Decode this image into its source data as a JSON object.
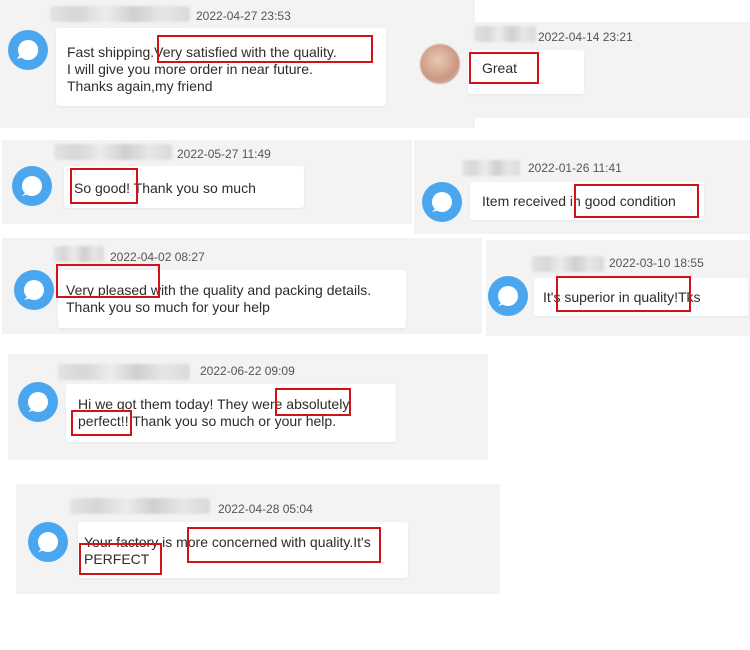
{
  "colors": {
    "card_bg": "#f3f3f3",
    "avatar": "#4aa6ee",
    "highlight": "#d0121b",
    "text": "#2c2c2c",
    "date": "#555555"
  },
  "icons": {
    "avatar": "default-avatar-icon"
  },
  "reviews": [
    {
      "date": "2022-04-27 23:53",
      "message": "Fast shipping.Very satisfied with the quality.\nI will give you more order in near future.\nThanks again,my friend"
    },
    {
      "date": "2022-04-14 23:21",
      "message": "Great"
    },
    {
      "date": "2022-05-27 11:49",
      "message": "So good! Thank you so much"
    },
    {
      "date": "2022-01-26 11:41",
      "message": "Item received in good condition"
    },
    {
      "date": "2022-04-02 08:27",
      "message": "Very pleased with the quality and packing details.\nThank you so much for your help"
    },
    {
      "date": "2022-03-10 18:55",
      "message": "It's superior in quality!Tks"
    },
    {
      "date": "2022-06-22 09:09",
      "message": "Hi we got them today! They were absolutely\nperfect!! Thank you so much or your help."
    },
    {
      "date": "2022-04-28 05:04",
      "message": "Your factory is more concerned with quality.It's\nPERFECT"
    }
  ]
}
